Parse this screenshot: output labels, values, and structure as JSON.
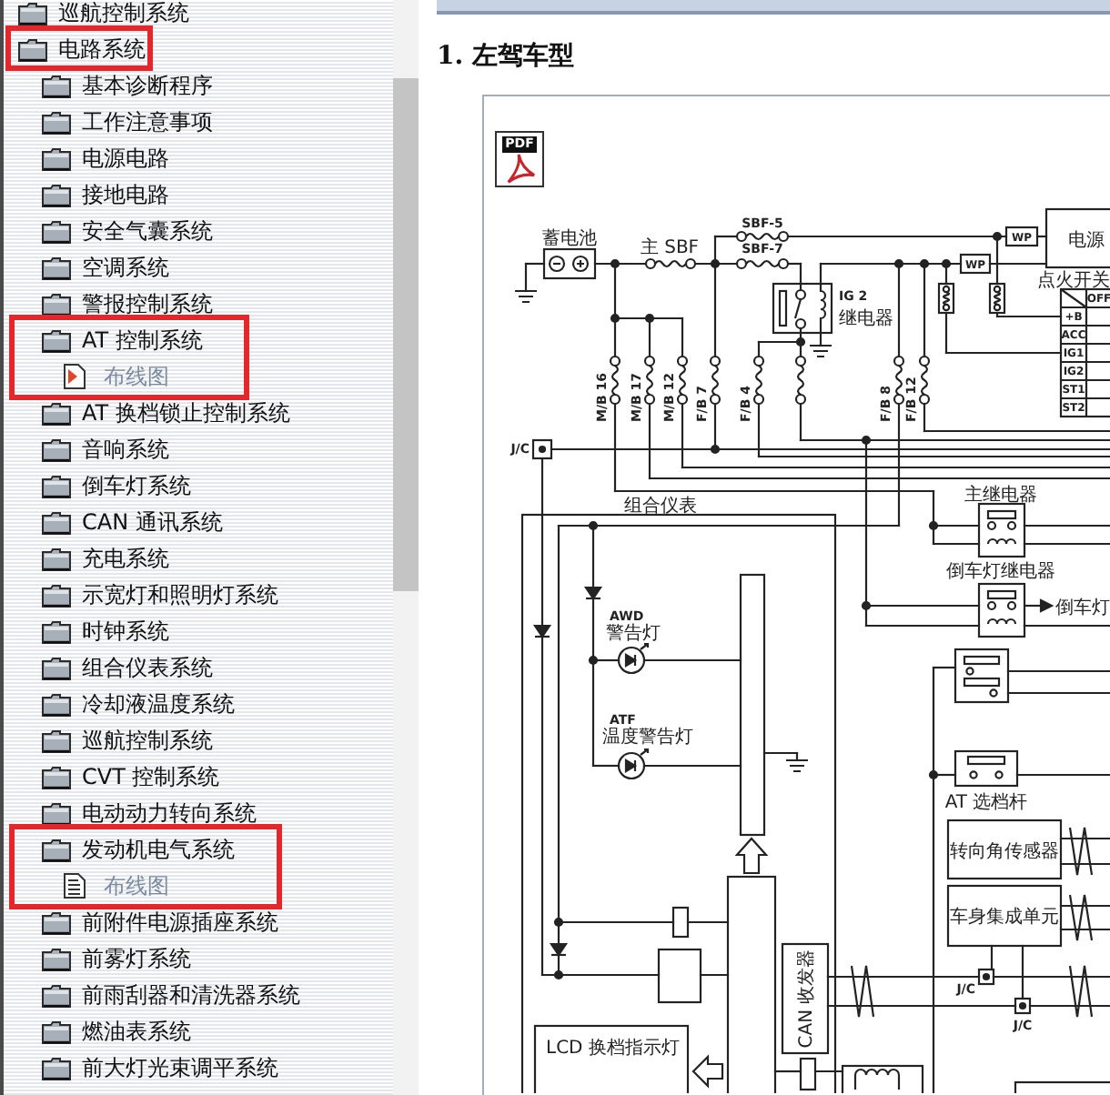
{
  "sidebar": {
    "tree": [
      {
        "label": "巡航控制系统",
        "kind": "folder",
        "selected": false,
        "highlighted": false
      },
      {
        "label": "电路系统",
        "kind": "folder",
        "selected": false,
        "highlighted": true,
        "children": [
          {
            "label": "基本诊断程序",
            "kind": "folder",
            "selected": false,
            "highlighted": false
          },
          {
            "label": "工作注意事项",
            "kind": "folder",
            "selected": false,
            "highlighted": false
          },
          {
            "label": "电源电路",
            "kind": "folder",
            "selected": false,
            "highlighted": false
          },
          {
            "label": "接地电路",
            "kind": "folder",
            "selected": false,
            "highlighted": false
          },
          {
            "label": "安全气囊系统",
            "kind": "folder",
            "selected": false,
            "highlighted": false
          },
          {
            "label": "空调系统",
            "kind": "folder",
            "selected": false,
            "highlighted": false
          },
          {
            "label": "警报控制系统",
            "kind": "folder",
            "selected": false,
            "highlighted": false
          },
          {
            "label": "AT 控制系统",
            "kind": "folder",
            "selected": false,
            "highlighted": true,
            "children": [
              {
                "label": "布线图",
                "kind": "page",
                "selected": true,
                "highlighted": true
              }
            ]
          },
          {
            "label": "AT 换档锁止控制系统",
            "kind": "folder",
            "selected": false,
            "highlighted": false
          },
          {
            "label": "音响系统",
            "kind": "folder",
            "selected": false,
            "highlighted": false
          },
          {
            "label": "倒车灯系统",
            "kind": "folder",
            "selected": false,
            "highlighted": false
          },
          {
            "label": "CAN 通讯系统",
            "kind": "folder",
            "selected": false,
            "highlighted": false
          },
          {
            "label": "充电系统",
            "kind": "folder",
            "selected": false,
            "highlighted": false
          },
          {
            "label": "示宽灯和照明灯系统",
            "kind": "folder",
            "selected": false,
            "highlighted": false
          },
          {
            "label": "时钟系统",
            "kind": "folder",
            "selected": false,
            "highlighted": false
          },
          {
            "label": "组合仪表系统",
            "kind": "folder",
            "selected": false,
            "highlighted": false
          },
          {
            "label": "冷却液温度系统",
            "kind": "folder",
            "selected": false,
            "highlighted": false
          },
          {
            "label": "巡航控制系统",
            "kind": "folder",
            "selected": false,
            "highlighted": false
          },
          {
            "label": "CVT 控制系统",
            "kind": "folder",
            "selected": false,
            "highlighted": false
          },
          {
            "label": "电动动力转向系统",
            "kind": "folder",
            "selected": false,
            "highlighted": false
          },
          {
            "label": "发动机电气系统",
            "kind": "folder",
            "selected": false,
            "highlighted": true,
            "children": [
              {
                "label": "布线图",
                "kind": "page",
                "selected": false,
                "highlighted": true
              }
            ]
          },
          {
            "label": "前附件电源插座系统",
            "kind": "folder",
            "selected": false,
            "highlighted": false
          },
          {
            "label": "前雾灯系统",
            "kind": "folder",
            "selected": false,
            "highlighted": false
          },
          {
            "label": "前雨刮器和清洗器系统",
            "kind": "folder",
            "selected": false,
            "highlighted": false
          },
          {
            "label": "燃油表系统",
            "kind": "folder",
            "selected": false,
            "highlighted": false
          },
          {
            "label": "前大灯光束调平系统",
            "kind": "folder",
            "selected": false,
            "highlighted": false
          }
        ]
      }
    ]
  },
  "content": {
    "heading": "1. 左驾车型",
    "pdf_link": {
      "label": "PDF"
    },
    "diagram": {
      "battery": "蓄电池",
      "main_fuse": "主 SBF",
      "fuse_upper": "SBF-5",
      "fuse_lower": "SBF-7",
      "relay": {
        "code": "IG 2",
        "name": "继电器"
      },
      "connectors_wp": [
        "WP",
        "WP"
      ],
      "power_box": "电源",
      "ignition_switch": {
        "title": "点火开关",
        "column_1": "OFF",
        "rows": [
          "+B",
          "ACC",
          "IG1",
          "IG2",
          "ST1",
          "ST2"
        ]
      },
      "fuses": [
        "M/B 16",
        "M/B 17",
        "M/B 12",
        "F/B 7",
        "F/B 4",
        "F/B 8",
        "F/B 12"
      ],
      "junctions": [
        "J/C",
        "J/C",
        "J/C"
      ],
      "cluster": "组合仪表",
      "awd_lamp": {
        "code": "AWD",
        "name": "警告灯"
      },
      "atf_lamp": {
        "code": "ATF",
        "name": "温度警告灯"
      },
      "main_relay": "主继电器",
      "reverse_relay": "倒车灯继电器",
      "reverse_lamp": "倒车灯",
      "selector": "AT 选档杆",
      "steering_sensor": "转向角传感器",
      "body_unit": "车身集成单元",
      "can_unit": "CAN 收发器",
      "lcd_panel": "LCD 换档指示灯"
    }
  }
}
